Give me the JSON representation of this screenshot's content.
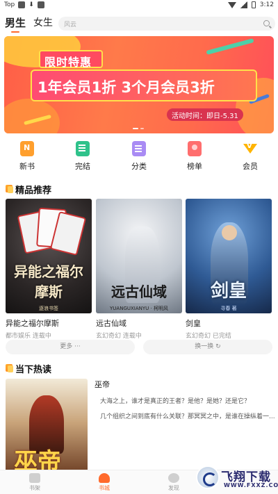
{
  "status_bar": {
    "left_label": "Top",
    "time": "3:12"
  },
  "top_tabs": {
    "male": "男生",
    "female": "女生"
  },
  "search": {
    "placeholder": "风云"
  },
  "banner": {
    "tag": "限时特惠",
    "headline": "1年会员1折  3个月会员3折",
    "date": "活动时间：即日-5.31"
  },
  "categories": [
    {
      "label": "新书",
      "icon": "new-book-icon"
    },
    {
      "label": "完结",
      "icon": "finished-book-icon"
    },
    {
      "label": "分类",
      "icon": "category-icon"
    },
    {
      "label": "榜单",
      "icon": "ranking-icon"
    },
    {
      "label": "会员",
      "icon": "vip-crown-icon"
    }
  ],
  "featured": {
    "title": "精品推荐",
    "books": [
      {
        "name": "异能之福尔摩斯",
        "meta": "都市娱乐 连载中",
        "cover_title": "异能之福尔摩斯",
        "cover_sub": "逐浪书签"
      },
      {
        "name": "远古仙域",
        "meta": "玄幻奇幻 连载中",
        "cover_title": "远古仙域",
        "cover_sub": "YUANGUXIANYU · 柯明风"
      },
      {
        "name": "剑皇",
        "meta": "玄幻奇幻 已完结",
        "cover_title": "剑皇",
        "cover_sub": "寻春 著"
      }
    ],
    "more_label": "更多 ···",
    "refresh_label": "换一换 ↻"
  },
  "hot": {
    "title": "当下热读",
    "book": {
      "name": "巫帝",
      "cover_title": "巫帝",
      "lines": [
        "大海之上，谁才是真正的王者？是他？是她？还是它？",
        "几个组织之间到底有什么关联？那冥冥之中，是谁在操纵着一..."
      ]
    }
  },
  "bottom_nav": [
    {
      "label": "书架",
      "active": false
    },
    {
      "label": "书城",
      "active": true
    },
    {
      "label": "发现",
      "active": false
    }
  ],
  "watermark": {
    "title": "飞翔下载",
    "url": "WWW.FXXZ.COM"
  },
  "colors": {
    "accent": "#ff6a2c",
    "banner_bg": "#ff6b4c"
  }
}
